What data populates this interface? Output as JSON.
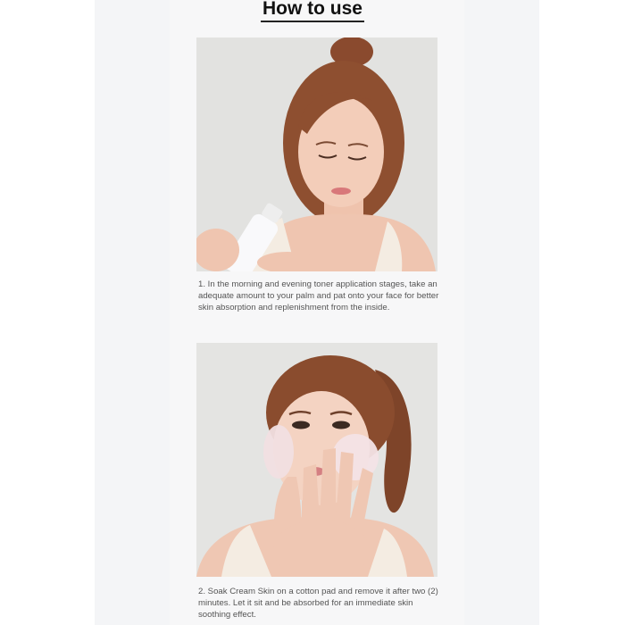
{
  "page": {
    "heading": "How to use"
  },
  "steps": [
    {
      "image_alt": "Woman pouring toner from a white bottle into her palm",
      "text": "1. In the morning and evening toner application stages, take an adequate amount to your palm and pat onto your face for better skin absorption and replenishment from the inside."
    },
    {
      "image_alt": "Woman holding soaked cotton pads against her cheeks",
      "text": "2. Soak Cream Skin on a cotton pad and remove it after two (2) minutes. Let it sit and be absorbed for an immediate skin soothing effect."
    }
  ],
  "colors": {
    "background": "#ffffff",
    "strip": "#f4f5f7",
    "heading": "#111111",
    "caption": "#555555"
  }
}
